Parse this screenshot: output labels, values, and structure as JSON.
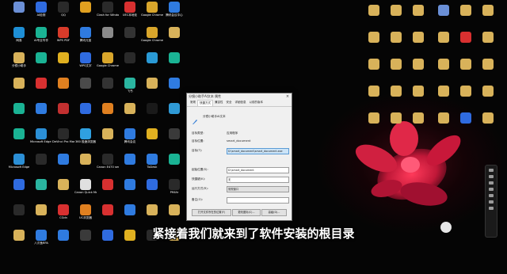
{
  "desktop": {
    "icons": [
      {
        "label": "",
        "color": "#6b8fd6"
      },
      {
        "label": "AI检测",
        "color": "#2f6be0"
      },
      {
        "label": "QQ",
        "color": "#2a2a2a"
      },
      {
        "label": "",
        "color": "#e0a020"
      },
      {
        "label": "Clash for Windows",
        "color": "#2a2a2a"
      },
      {
        "label": "UEC本地化",
        "color": "#d83030"
      },
      {
        "label": "Google Chrome",
        "color": "#d9a62b"
      },
      {
        "label": "腾讯会议中心",
        "color": "#2f7be0"
      },
      {
        "label": "网易",
        "color": "#1e8fd6"
      },
      {
        "label": "AI专业写作",
        "color": "#1ab394"
      },
      {
        "label": "WPS PDF",
        "color": "#d83b2a"
      },
      {
        "label": "腾讯元宝",
        "color": "#2f7be0"
      },
      {
        "label": "",
        "color": "#8a8a8a"
      },
      {
        "label": "",
        "color": "#333"
      },
      {
        "label": "Google Chrome",
        "color": "#d9a62b"
      },
      {
        "label": "",
        "color": "#d8b25a"
      },
      {
        "label": "分镜小助手",
        "color": "#d8b25a"
      },
      {
        "label": "",
        "color": "#1ab394"
      },
      {
        "label": "",
        "color": "#e0b020"
      },
      {
        "label": "WPS文字",
        "color": "#2f6be0"
      },
      {
        "label": "Google Chrome",
        "color": "#d9a62b"
      },
      {
        "label": "",
        "color": "#2a2a2a"
      },
      {
        "label": "",
        "color": "#2a9ad6"
      },
      {
        "label": "",
        "color": "#1ab394"
      },
      {
        "label": "",
        "color": "#d8b25a"
      },
      {
        "label": "",
        "color": "#d83030"
      },
      {
        "label": "",
        "color": "#e08020"
      },
      {
        "label": "",
        "color": "#4a4a4a"
      },
      {
        "label": "",
        "color": "#333"
      },
      {
        "label": "飞书",
        "color": "#2ab5a0"
      },
      {
        "label": "",
        "color": "#d8b25a"
      },
      {
        "label": "",
        "color": "#2f7be0"
      },
      {
        "label": "",
        "color": "#1ab394"
      },
      {
        "label": "",
        "color": "#2f7be0"
      },
      {
        "label": "",
        "color": "#c23030"
      },
      {
        "label": "",
        "color": "#2f6be0"
      },
      {
        "label": "",
        "color": "#e08020"
      },
      {
        "label": "",
        "color": "#d8b25a"
      },
      {
        "label": "",
        "color": "#1a1a1a"
      },
      {
        "label": "",
        "color": "#2f9ad6"
      },
      {
        "label": "",
        "color": "#1ab394"
      },
      {
        "label": "Microsoft Edge Dev",
        "color": "#2b8fd6"
      },
      {
        "label": "DeVinci Pro Master",
        "color": "#2a2a2a"
      },
      {
        "label": "360 极速浏览器",
        "color": "#2fa0e0"
      },
      {
        "label": "",
        "color": "#d8b25a"
      },
      {
        "label": "腾讯会议",
        "color": "#2f7be0"
      },
      {
        "label": "",
        "color": "#e0b020"
      },
      {
        "label": "",
        "color": "#3a3a3a"
      },
      {
        "label": "Microsoft Edge",
        "color": "#2b8fd6"
      },
      {
        "label": "",
        "color": "#2a2a2a"
      },
      {
        "label": "",
        "color": "#2f7be0"
      },
      {
        "label": "",
        "color": "#d8b25a"
      },
      {
        "label": "Canon E470 series",
        "color": "#2a2a2a"
      },
      {
        "label": "",
        "color": "#2f7be0"
      },
      {
        "label": "ToDesk",
        "color": "#2f7be0"
      },
      {
        "label": "",
        "color": "#1ab394"
      },
      {
        "label": "",
        "color": "#2f6be0"
      },
      {
        "label": "",
        "color": "#2ab5a0"
      },
      {
        "label": "",
        "color": "#d8b25a"
      },
      {
        "label": "Canon Quick Menu",
        "color": "#e0e0e0"
      },
      {
        "label": "",
        "color": "#d83030"
      },
      {
        "label": "",
        "color": "#2f7be0"
      },
      {
        "label": "",
        "color": "#2f6be0"
      },
      {
        "label": "PMUtr",
        "color": "#2a2a2a"
      },
      {
        "label": "",
        "color": "#2a2a2a"
      },
      {
        "label": "",
        "color": "#d8b25a"
      },
      {
        "label": "CGdn",
        "color": "#d83030"
      },
      {
        "label": "UC浏览器",
        "color": "#e08020"
      },
      {
        "label": "",
        "color": "#d83030"
      },
      {
        "label": "",
        "color": "#2f7be0"
      },
      {
        "label": "",
        "color": "#d8b25a"
      },
      {
        "label": "",
        "color": "#d8b25a"
      },
      {
        "label": "",
        "color": "#d8b25a"
      },
      {
        "label": "八爪鱼RPA",
        "color": "#2f7be0"
      },
      {
        "label": "",
        "color": "#2f7be0"
      },
      {
        "label": "",
        "color": "#3a3a3a"
      },
      {
        "label": "",
        "color": "#2f6be0"
      },
      {
        "label": "",
        "color": "#e0b020"
      },
      {
        "label": "",
        "color": "#2a2a2a"
      },
      {
        "label": "",
        "color": "#d8b25a"
      }
    ],
    "right_icons": [
      {
        "label": "",
        "color": "#d8b25a"
      },
      {
        "label": "",
        "color": "#d8b25a"
      },
      {
        "label": "",
        "color": "#d8b25a"
      },
      {
        "label": "",
        "color": "#6a8fd6"
      },
      {
        "label": "",
        "color": "#d8b25a"
      },
      {
        "label": "",
        "color": "#d8b25a"
      },
      {
        "label": "",
        "color": "#d8b25a"
      },
      {
        "label": "",
        "color": "#d8b25a"
      },
      {
        "label": "",
        "color": "#d8b25a"
      },
      {
        "label": "",
        "color": "#d8b25a"
      },
      {
        "label": "",
        "color": "#d83030"
      },
      {
        "label": "",
        "color": "#d8b25a"
      },
      {
        "label": "",
        "color": "#d8b25a"
      },
      {
        "label": "",
        "color": "#d8b25a"
      },
      {
        "label": "",
        "color": "#d8b25a"
      },
      {
        "label": "",
        "color": "#d8b25a"
      },
      {
        "label": "",
        "color": "#d8b25a"
      },
      {
        "label": "",
        "color": "#d8b25a"
      },
      {
        "label": "",
        "color": "#d8b25a"
      },
      {
        "label": "",
        "color": "#d8b25a"
      },
      {
        "label": "",
        "color": "#d8b25a"
      },
      {
        "label": "",
        "color": "#d8b25a"
      },
      {
        "label": "",
        "color": "#d8b25a"
      },
      {
        "label": "",
        "color": "#d8b25a"
      },
      {
        "label": "",
        "color": "#d8b25a"
      },
      {
        "label": "",
        "color": "#d8b25a"
      },
      {
        "label": "",
        "color": "#d8b25a"
      },
      {
        "label": "",
        "color": "#d8b25a"
      },
      {
        "label": "",
        "color": "#2f6be0"
      },
      {
        "label": "",
        "color": "#d8b25a"
      }
    ]
  },
  "dialog": {
    "title": "分镜小助手AI文本 属性",
    "close": "×",
    "tabs": [
      "常规",
      "快捷方式",
      "兼容性",
      "安全",
      "详细信息",
      "以前的版本"
    ],
    "selected_tab": 1,
    "app_name": "分镜小助手AI文本",
    "fields": [
      {
        "label": "目标类型:",
        "value": "应用程序"
      },
      {
        "label": "目标位置:",
        "value": "smart_document"
      },
      {
        "label": "目标(T):",
        "value": "D:\\smart_document\\smart_document.exe",
        "highlight": true
      },
      {
        "label": "起始位置(S):",
        "value": "D:\\smart_document"
      },
      {
        "label": "快捷键(K):",
        "value": "无"
      },
      {
        "label": "运行方式(R):",
        "value": "常规窗口"
      },
      {
        "label": "备注(O):",
        "value": ""
      }
    ],
    "buttons": [
      "打开文件所在的位置(F)",
      "更改图标(C)...",
      "高级(D)..."
    ]
  },
  "subtitle": "紧接着我们就来到了软件安装的根目录"
}
